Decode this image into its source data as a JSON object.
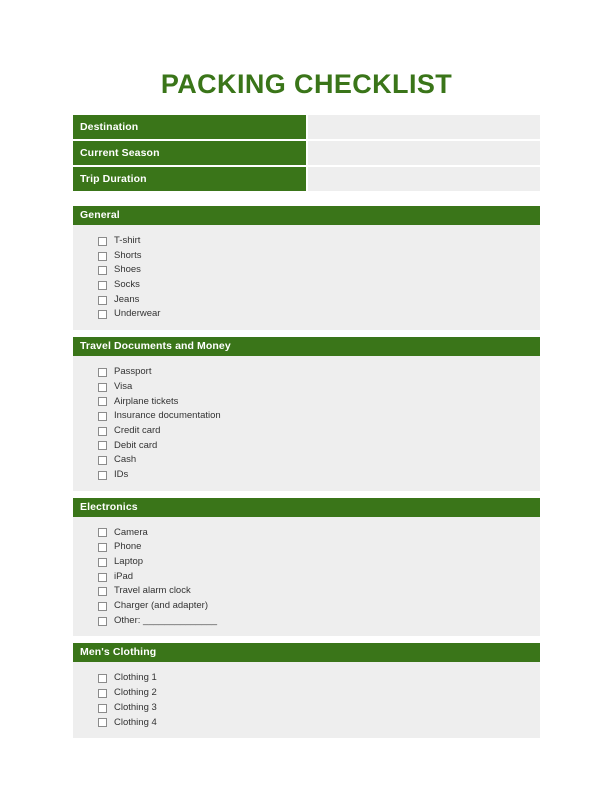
{
  "document": {
    "title": "PACKING CHECKLIST"
  },
  "colors": {
    "accent_green": "#3a7519",
    "field_gray": "#eeeeee",
    "text": "#333333",
    "page_background": "#ffffff"
  },
  "info_table": {
    "rows": [
      {
        "label": "Destination",
        "value": ""
      },
      {
        "label": "Current Season",
        "value": ""
      },
      {
        "label": "Trip Duration",
        "value": ""
      }
    ]
  },
  "sections": [
    {
      "title": "General",
      "items": [
        {
          "label": "T-shirt",
          "checked": false
        },
        {
          "label": "Shorts",
          "checked": false
        },
        {
          "label": "Shoes",
          "checked": false
        },
        {
          "label": "Socks",
          "checked": false
        },
        {
          "label": "Jeans",
          "checked": false
        },
        {
          "label": "Underwear",
          "checked": false
        }
      ]
    },
    {
      "title": "Travel Documents and Money",
      "items": [
        {
          "label": "Passport",
          "checked": false
        },
        {
          "label": "Visa",
          "checked": false
        },
        {
          "label": "Airplane tickets",
          "checked": false
        },
        {
          "label": "Insurance documentation",
          "checked": false
        },
        {
          "label": "Credit card",
          "checked": false
        },
        {
          "label": "Debit card",
          "checked": false
        },
        {
          "label": "Cash",
          "checked": false
        },
        {
          "label": "IDs",
          "checked": false
        }
      ]
    },
    {
      "title": "Electronics",
      "items": [
        {
          "label": "Camera",
          "checked": false
        },
        {
          "label": "Phone",
          "checked": false
        },
        {
          "label": "Laptop",
          "checked": false
        },
        {
          "label": "iPad",
          "checked": false
        },
        {
          "label": "Travel alarm clock",
          "checked": false
        },
        {
          "label": "Charger (and adapter)",
          "checked": false
        },
        {
          "label": "Other: ______________",
          "checked": false
        }
      ]
    },
    {
      "title": "Men's Clothing",
      "items": [
        {
          "label": "Clothing 1",
          "checked": false
        },
        {
          "label": "Clothing 2",
          "checked": false
        },
        {
          "label": "Clothing 3",
          "checked": false
        },
        {
          "label": "Clothing 4",
          "checked": false
        }
      ]
    }
  ]
}
